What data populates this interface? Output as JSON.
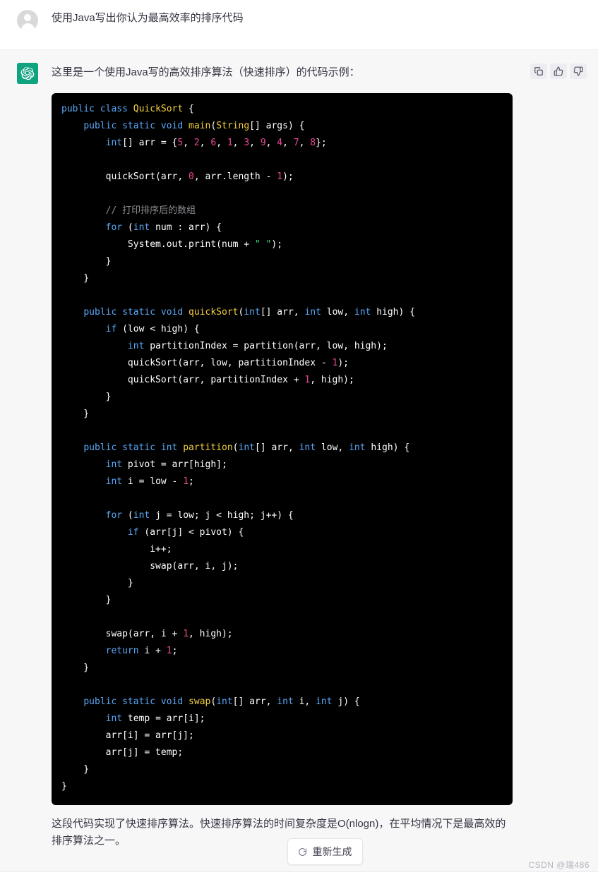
{
  "user_turn": {
    "avatar_name": "user-avatar",
    "message": "使用Java写出你认为最高效率的排序代码"
  },
  "assistant_turn": {
    "avatar_name": "chatgpt-logo",
    "brand_color": "#10a37f",
    "intro": "这里是一个使用Java写的高效排序算法（快速排序）的代码示例：",
    "actions": [
      {
        "name": "copy-icon",
        "label": "Copy"
      },
      {
        "name": "thumbs-up-icon",
        "label": "Good response"
      },
      {
        "name": "thumbs-down-icon",
        "label": "Bad response"
      }
    ],
    "code_block": {
      "language": "java",
      "background": "#000000",
      "lines": [
        [
          [
            "k",
            "public"
          ],
          [
            "p",
            " "
          ],
          [
            "k",
            "class"
          ],
          [
            "p",
            " "
          ],
          [
            "fn",
            "QuickSort"
          ],
          [
            "p",
            " {"
          ]
        ],
        [
          [
            "p",
            "    "
          ],
          [
            "k",
            "public"
          ],
          [
            "p",
            " "
          ],
          [
            "k",
            "static"
          ],
          [
            "p",
            " "
          ],
          [
            "k",
            "void"
          ],
          [
            "p",
            " "
          ],
          [
            "fn",
            "main"
          ],
          [
            "p",
            "("
          ],
          [
            "fn",
            "String"
          ],
          [
            "p",
            "[] args) {"
          ]
        ],
        [
          [
            "p",
            "        "
          ],
          [
            "k",
            "int"
          ],
          [
            "p",
            "[] arr = {"
          ],
          [
            "n",
            "5"
          ],
          [
            "p",
            ", "
          ],
          [
            "n",
            "2"
          ],
          [
            "p",
            ", "
          ],
          [
            "n",
            "6"
          ],
          [
            "p",
            ", "
          ],
          [
            "n",
            "1"
          ],
          [
            "p",
            ", "
          ],
          [
            "n",
            "3"
          ],
          [
            "p",
            ", "
          ],
          [
            "n",
            "9"
          ],
          [
            "p",
            ", "
          ],
          [
            "n",
            "4"
          ],
          [
            "p",
            ", "
          ],
          [
            "n",
            "7"
          ],
          [
            "p",
            ", "
          ],
          [
            "n",
            "8"
          ],
          [
            "p",
            "};"
          ]
        ],
        [
          [
            "p",
            ""
          ]
        ],
        [
          [
            "p",
            "        quickSort(arr, "
          ],
          [
            "n",
            "0"
          ],
          [
            "p",
            ", arr.length - "
          ],
          [
            "n",
            "1"
          ],
          [
            "p",
            ");"
          ]
        ],
        [
          [
            "p",
            ""
          ]
        ],
        [
          [
            "c",
            "        // 打印排序后的数组"
          ]
        ],
        [
          [
            "p",
            "        "
          ],
          [
            "k",
            "for"
          ],
          [
            "p",
            " ("
          ],
          [
            "k",
            "int"
          ],
          [
            "p",
            " num : arr) {"
          ]
        ],
        [
          [
            "p",
            "            System.out.print(num + "
          ],
          [
            "s",
            "\" \""
          ],
          [
            "p",
            ");"
          ]
        ],
        [
          [
            "p",
            "        }"
          ]
        ],
        [
          [
            "p",
            "    }"
          ]
        ],
        [
          [
            "p",
            ""
          ]
        ],
        [
          [
            "p",
            "    "
          ],
          [
            "k",
            "public"
          ],
          [
            "p",
            " "
          ],
          [
            "k",
            "static"
          ],
          [
            "p",
            " "
          ],
          [
            "k",
            "void"
          ],
          [
            "p",
            " "
          ],
          [
            "fn",
            "quickSort"
          ],
          [
            "p",
            "("
          ],
          [
            "k",
            "int"
          ],
          [
            "p",
            "[] arr, "
          ],
          [
            "k",
            "int"
          ],
          [
            "p",
            " low, "
          ],
          [
            "k",
            "int"
          ],
          [
            "p",
            " high) {"
          ]
        ],
        [
          [
            "p",
            "        "
          ],
          [
            "k",
            "if"
          ],
          [
            "p",
            " (low < high) {"
          ]
        ],
        [
          [
            "p",
            "            "
          ],
          [
            "k",
            "int"
          ],
          [
            "p",
            " partitionIndex = partition(arr, low, high);"
          ]
        ],
        [
          [
            "p",
            "            quickSort(arr, low, partitionIndex - "
          ],
          [
            "n",
            "1"
          ],
          [
            "p",
            ");"
          ]
        ],
        [
          [
            "p",
            "            quickSort(arr, partitionIndex + "
          ],
          [
            "n",
            "1"
          ],
          [
            "p",
            ", high);"
          ]
        ],
        [
          [
            "p",
            "        }"
          ]
        ],
        [
          [
            "p",
            "    }"
          ]
        ],
        [
          [
            "p",
            ""
          ]
        ],
        [
          [
            "p",
            "    "
          ],
          [
            "k",
            "public"
          ],
          [
            "p",
            " "
          ],
          [
            "k",
            "static"
          ],
          [
            "p",
            " "
          ],
          [
            "k",
            "int"
          ],
          [
            "p",
            " "
          ],
          [
            "fn",
            "partition"
          ],
          [
            "p",
            "("
          ],
          [
            "k",
            "int"
          ],
          [
            "p",
            "[] arr, "
          ],
          [
            "k",
            "int"
          ],
          [
            "p",
            " low, "
          ],
          [
            "k",
            "int"
          ],
          [
            "p",
            " high) {"
          ]
        ],
        [
          [
            "p",
            "        "
          ],
          [
            "k",
            "int"
          ],
          [
            "p",
            " pivot = arr[high];"
          ]
        ],
        [
          [
            "p",
            "        "
          ],
          [
            "k",
            "int"
          ],
          [
            "p",
            " i = low - "
          ],
          [
            "n",
            "1"
          ],
          [
            "p",
            ";"
          ]
        ],
        [
          [
            "p",
            ""
          ]
        ],
        [
          [
            "p",
            "        "
          ],
          [
            "k",
            "for"
          ],
          [
            "p",
            " ("
          ],
          [
            "k",
            "int"
          ],
          [
            "p",
            " j = low; j < high; j++) {"
          ]
        ],
        [
          [
            "p",
            "            "
          ],
          [
            "k",
            "if"
          ],
          [
            "p",
            " (arr[j] < pivot) {"
          ]
        ],
        [
          [
            "p",
            "                i++;"
          ]
        ],
        [
          [
            "p",
            "                swap(arr, i, j);"
          ]
        ],
        [
          [
            "p",
            "            }"
          ]
        ],
        [
          [
            "p",
            "        }"
          ]
        ],
        [
          [
            "p",
            ""
          ]
        ],
        [
          [
            "p",
            "        swap(arr, i + "
          ],
          [
            "n",
            "1"
          ],
          [
            "p",
            ", high);"
          ]
        ],
        [
          [
            "p",
            "        "
          ],
          [
            "k",
            "return"
          ],
          [
            "p",
            " i + "
          ],
          [
            "n",
            "1"
          ],
          [
            "p",
            ";"
          ]
        ],
        [
          [
            "p",
            "    }"
          ]
        ],
        [
          [
            "p",
            ""
          ]
        ],
        [
          [
            "p",
            "    "
          ],
          [
            "k",
            "public"
          ],
          [
            "p",
            " "
          ],
          [
            "k",
            "static"
          ],
          [
            "p",
            " "
          ],
          [
            "k",
            "void"
          ],
          [
            "p",
            " "
          ],
          [
            "fn",
            "swap"
          ],
          [
            "p",
            "("
          ],
          [
            "k",
            "int"
          ],
          [
            "p",
            "[] arr, "
          ],
          [
            "k",
            "int"
          ],
          [
            "p",
            " i, "
          ],
          [
            "k",
            "int"
          ],
          [
            "p",
            " j) {"
          ]
        ],
        [
          [
            "p",
            "        "
          ],
          [
            "k",
            "int"
          ],
          [
            "p",
            " temp = arr[i];"
          ]
        ],
        [
          [
            "p",
            "        arr[i] = arr[j];"
          ]
        ],
        [
          [
            "p",
            "        arr[j] = temp;"
          ]
        ],
        [
          [
            "p",
            "    }"
          ]
        ],
        [
          [
            "p",
            "}"
          ]
        ]
      ]
    },
    "outro": "这段代码实现了快速排序算法。快速排序算法的时间复杂度是O(nlogn)，在平均情况下是最高效的排序算法之一。"
  },
  "footer": {
    "regenerate_label": "重新生成",
    "regenerate_icon": "refresh-icon",
    "watermark": "CSDN @瑞486"
  }
}
